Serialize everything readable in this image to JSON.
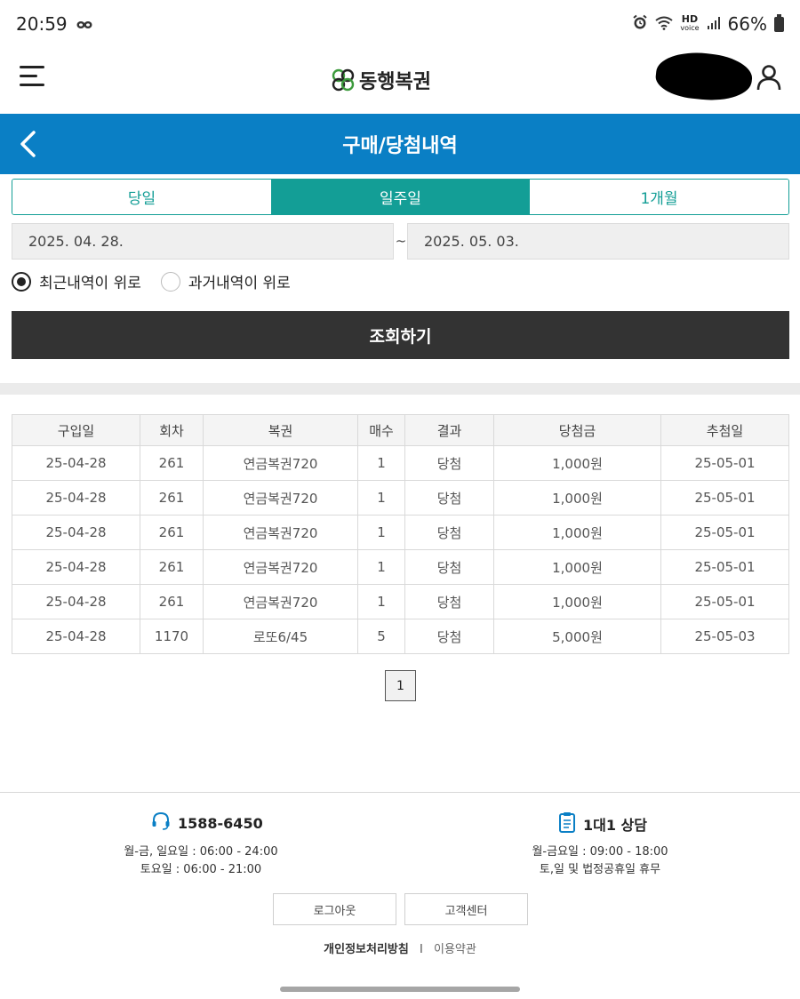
{
  "status_bar": {
    "time": "20:59",
    "hd_label": "HD",
    "voice_label": "voice",
    "battery": "66%"
  },
  "header": {
    "logo_text": "동행복권"
  },
  "title_bar": {
    "title": "구매/당첨내역"
  },
  "period_tabs": [
    {
      "label": "당일",
      "active": false
    },
    {
      "label": "일주일",
      "active": true
    },
    {
      "label": "1개월",
      "active": false
    }
  ],
  "date_range": {
    "start": "2025. 04. 28.",
    "separator": "~",
    "end": "2025. 05. 03."
  },
  "sort_options": {
    "recent_first": "최근내역이 위로",
    "past_first": "과거내역이 위로",
    "selected": "recent_first"
  },
  "search_button": "조회하기",
  "table": {
    "headers": [
      "구입일",
      "회차",
      "복권",
      "매수",
      "결과",
      "당첨금",
      "추첨일"
    ],
    "rows": [
      [
        "25-04-28",
        "261",
        "연금복권720",
        "1",
        "당첨",
        "1,000원",
        "25-05-01"
      ],
      [
        "25-04-28",
        "261",
        "연금복권720",
        "1",
        "당첨",
        "1,000원",
        "25-05-01"
      ],
      [
        "25-04-28",
        "261",
        "연금복권720",
        "1",
        "당첨",
        "1,000원",
        "25-05-01"
      ],
      [
        "25-04-28",
        "261",
        "연금복권720",
        "1",
        "당첨",
        "1,000원",
        "25-05-01"
      ],
      [
        "25-04-28",
        "261",
        "연금복권720",
        "1",
        "당첨",
        "1,000원",
        "25-05-01"
      ],
      [
        "25-04-28",
        "1170",
        "로또6/45",
        "5",
        "당첨",
        "5,000원",
        "25-05-03"
      ]
    ]
  },
  "pagination": {
    "current": "1"
  },
  "footer": {
    "phone": {
      "number": "1588-6450",
      "hours_line1": "월-금, 일요일 : 06:00 - 24:00",
      "hours_line2": "토요일 : 06:00 - 21:00"
    },
    "consult": {
      "title": "1대1 상담",
      "hours_line1": "월-금요일 : 09:00 - 18:00",
      "hours_line2": "토,일 및 법정공휴일 휴무"
    },
    "logout_button": "로그아웃",
    "support_button": "고객센터",
    "privacy_link": "개인정보처리방침",
    "divider": "I",
    "terms_link": "이용약관"
  },
  "colors": {
    "brand_blue": "#0a7fc5",
    "teal": "#139e96",
    "dark_button": "#333333"
  }
}
